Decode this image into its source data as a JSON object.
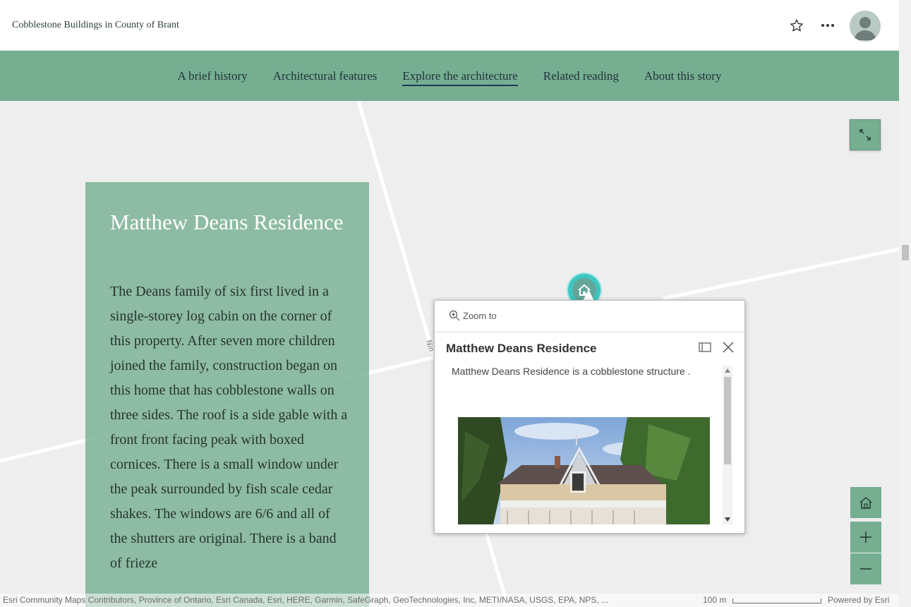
{
  "header": {
    "story_title": "Cobblestone Buildings in County of Brant",
    "favorite_icon": "star-icon",
    "more_icon": "more-options-icon",
    "avatar_icon": "user-avatar-icon"
  },
  "nav": {
    "items": [
      {
        "label": "A brief history",
        "active": false
      },
      {
        "label": "Architectural features",
        "active": false
      },
      {
        "label": "Explore the architecture",
        "active": true
      },
      {
        "label": "Related reading",
        "active": false
      },
      {
        "label": "About this story",
        "active": false
      }
    ]
  },
  "panel": {
    "heading": "Matthew Deans Residence",
    "body": "The Deans family of six first lived in a single-storey log cabin on the corner of this property. After seven more children joined the family, construction began on this home that has cobblestone walls on three sides. The roof is a side gable with a front front facing peak with boxed cornices. There is a small window under the peak surrounded by fish scale cedar shakes. The windows are 6/6 and all of the shutters are original. There is a band of frieze"
  },
  "map": {
    "road_label": "Ninth Ln",
    "road_label_short": "Nin"
  },
  "popup": {
    "zoom_to_label": "Zoom to",
    "title": "Matthew Deans Residence",
    "content": "Matthew Deans Residence is a cobblestone structure .",
    "photo_alt": "Photo of Matthew Deans Residence"
  },
  "attribution": {
    "text": "Esri Community Maps Contributors, Province of Ontario, Esri Canada, Esri, HERE, Garmin, SafeGraph, GeoTechnologies, Inc, METI/NASA, USGS, EPA, NPS, ...",
    "scale_label": "100 m",
    "powered_by": "Powered by Esri"
  },
  "colors": {
    "nav_bg": "#76ae92",
    "panel_bg": "#80b498",
    "marker": "#3cc6c1"
  }
}
